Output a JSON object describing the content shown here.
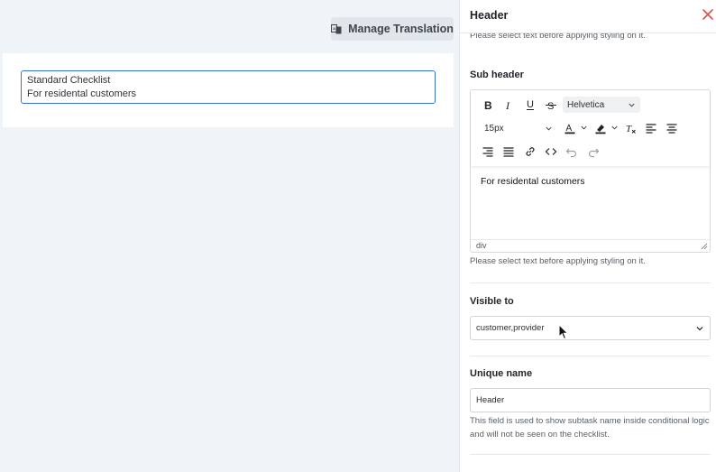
{
  "toolbar_top": {
    "manage_translation_label": "Manage Translation"
  },
  "checklist_preview": {
    "title_line": "Standard Checklist",
    "subtitle_line": "For residental customers"
  },
  "panel": {
    "title": "Header",
    "style_hint_top": "Please select text before applying styling on it.",
    "sub_header": {
      "label": "Sub header",
      "font_family": "Helvetica",
      "font_size": "15px",
      "content": "For residental customers",
      "status_path": "div",
      "style_hint": "Please select text before applying styling on it."
    },
    "visible_to": {
      "label": "Visible to",
      "value": "customer,provider"
    },
    "unique_name": {
      "label": "Unique name",
      "value": "Header",
      "help": "This field is used to show subtask name inside conditional logic and will not be seen on the checklist."
    }
  },
  "colors": {
    "accent_blue": "#3a6fd8",
    "close_red": "#d9534f",
    "canvas_bg": "#eff4f9"
  }
}
